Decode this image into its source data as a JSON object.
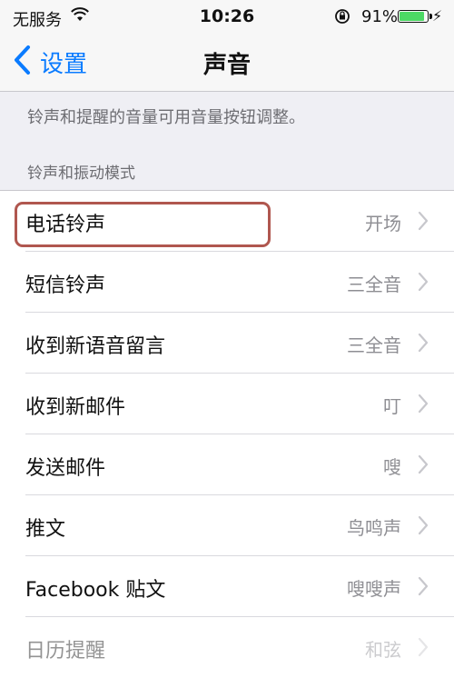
{
  "status_bar": {
    "carrier": "无服务",
    "time": "10:26",
    "battery_percent": "91%",
    "battery_level": 0.91,
    "battery_color": "#4cd964",
    "icons": [
      "wifi-icon",
      "rotation-lock-icon",
      "battery-icon",
      "charging-bolt-icon"
    ]
  },
  "nav": {
    "back_label": "设置",
    "title": "声音",
    "accent_color": "#0a7bff"
  },
  "hint": "铃声和提醒的音量可用音量按钮调整。",
  "section_header": "铃声和振动模式",
  "rows": [
    {
      "label": "电话铃声",
      "value": "开场"
    },
    {
      "label": "短信铃声",
      "value": "三全音"
    },
    {
      "label": "收到新语音留言",
      "value": "三全音"
    },
    {
      "label": "收到新邮件",
      "value": "叮"
    },
    {
      "label": "发送邮件",
      "value": "嗖"
    },
    {
      "label": "推文",
      "value": "鸟鸣声"
    },
    {
      "label": "Facebook 贴文",
      "value": "嗖嗖声"
    },
    {
      "label": "日历提醒",
      "value": "和弦"
    }
  ],
  "highlight_color": "#b0574f"
}
